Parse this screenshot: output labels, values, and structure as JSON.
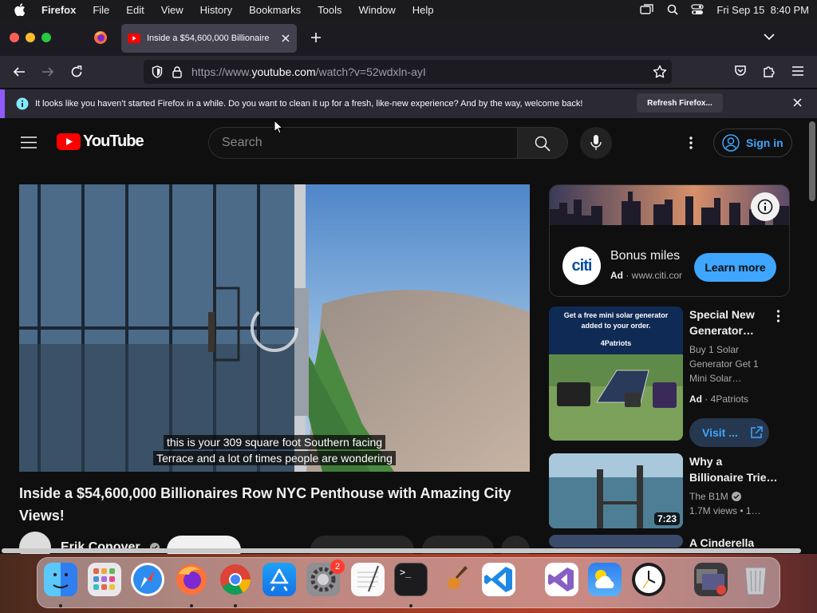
{
  "menubar": {
    "app": "Firefox",
    "items": [
      "File",
      "Edit",
      "View",
      "History",
      "Bookmarks",
      "Tools",
      "Window",
      "Help"
    ],
    "clock": "Fri Sep 15  8:40 PM"
  },
  "browser": {
    "tab_title": "Inside a $54,600,000 Billionaire",
    "url_prefix": "https://www.",
    "url_host": "youtube.com",
    "url_path": "/watch?v=52wdxln-ayI",
    "notification": "It looks like you haven’t started Firefox in a while. Do you want to clean it up for a fresh, like-new experience? And by the way, welcome back!",
    "notification_button": "Refresh Firefox..."
  },
  "youtube": {
    "logo": "YouTube",
    "search_placeholder": "Search",
    "signin": "Sign in",
    "caption_line1": "this is your 309 square foot Southern facing",
    "caption_line2": "Terrace and a lot of times people are wondering",
    "video_title": "Inside a $54,600,000 Billionaires Row NYC Penthouse with Amazing City Views!",
    "channel": "Erik Conover",
    "ad_card": {
      "logo": "citi",
      "title": "Bonus miles",
      "ad_label": "Ad",
      "domain": "www.citi.cor",
      "cta": "Learn more"
    },
    "recommendations": [
      {
        "thumb_text1": "Get a free mini solar generator",
        "thumb_text2": "added to your order.",
        "thumb_brand": "4Patriots",
        "title_line1": "Special New",
        "title_line2": "Generator…",
        "desc1": "Buy 1 Solar",
        "desc2": "Generator Get 1",
        "desc3": "Mini Solar…",
        "ad_label": "Ad",
        "advertiser": "4Patriots",
        "cta": "Visit ..."
      },
      {
        "title_line1": "Why a",
        "title_line2": "Billionaire Trie…",
        "channel": "The B1M",
        "views": "1.7M views",
        "age": "1…",
        "duration": "7:23"
      },
      {
        "title_line1": "A Cinderella Story:"
      }
    ]
  },
  "dock": {
    "settings_badge": "2"
  }
}
